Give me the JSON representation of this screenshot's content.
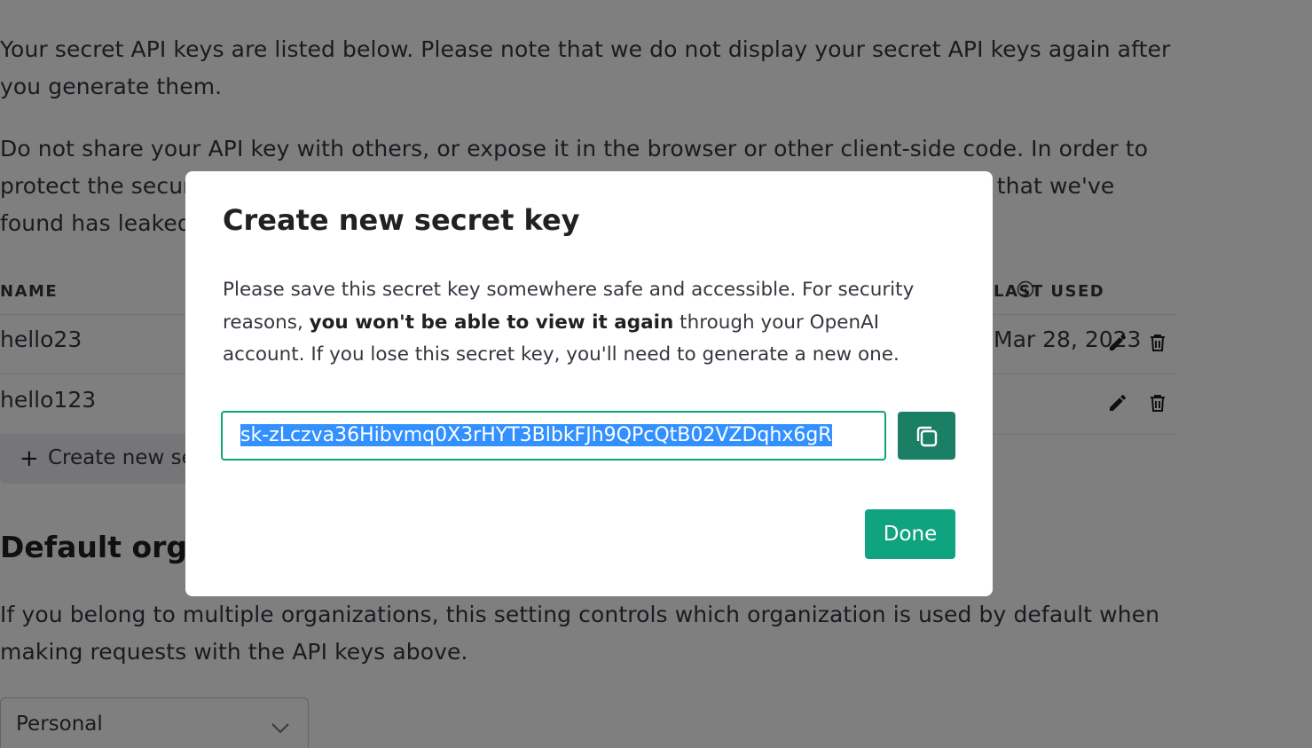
{
  "background": {
    "intro_paragraph": "Your secret API keys are listed below. Please note that we do not display your secret API keys again after you generate them.",
    "warning_paragraph": "Do not share your API key with others, or expose it in the browser or other client-side code. In order to protect the security of your account, OpenAI may also automatically disable any API key that we've found has leaked publicly.",
    "table": {
      "columns": [
        "NAME",
        "LAST USED"
      ],
      "rows": [
        {
          "name": "hello23",
          "last_used": "Mar 28, 2023"
        },
        {
          "name": "hello123",
          "last_used": ""
        }
      ]
    },
    "create_button_label": "Create new secret key",
    "default_org_title": "Default organization",
    "default_org_description": "If you belong to multiple organizations, this setting controls which organization is used by default when making requests with the API keys above.",
    "org_select_value": "Personal"
  },
  "modal": {
    "title": "Create new secret key",
    "description_before": "Please save this secret key somewhere safe and accessible. For security reasons, ",
    "description_bold": "you won't be able to view it again",
    "description_after": " through your OpenAI account. If you lose this secret key, you'll need to generate a new one.",
    "secret_key_value": "sk-zLczva36Hibvmq0X3rHYT3BlbkFJh9QPcQtB02VZDqhx6gR",
    "copy_icon": "copy-icon",
    "done_label": "Done"
  },
  "colors": {
    "accent": "#10a37f",
    "copy_button": "#1a7f64",
    "selection": "#3390ff"
  }
}
